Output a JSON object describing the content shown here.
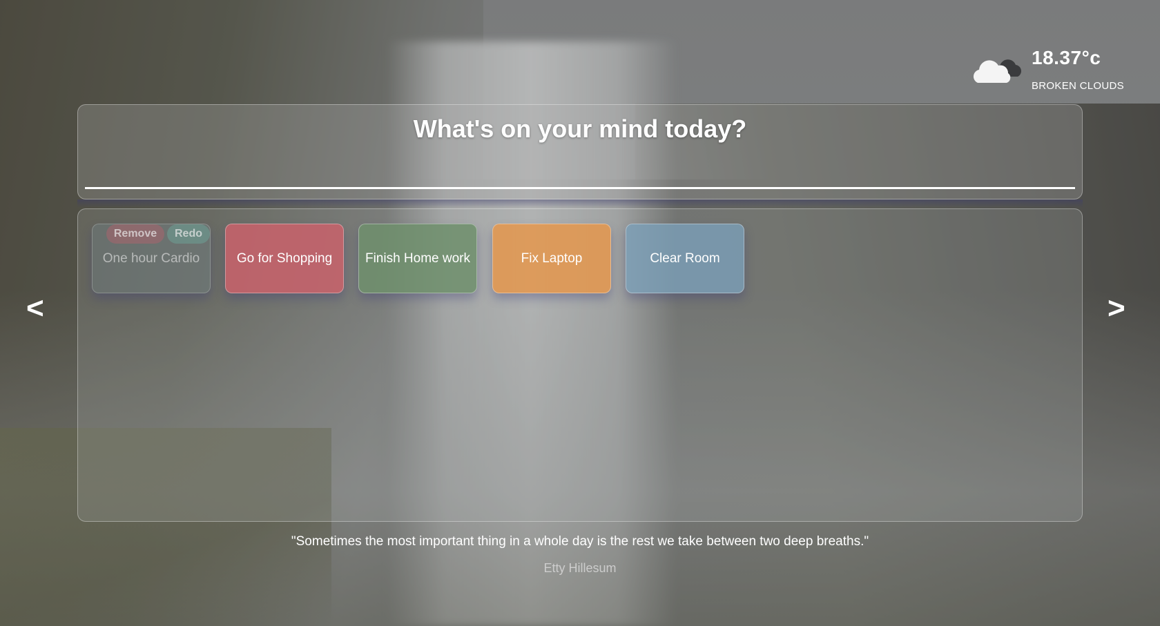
{
  "weather": {
    "icon": "broken-clouds-icon",
    "temperature": "18.37°c",
    "description": "BROKEN CLOUDS"
  },
  "input_panel": {
    "title": "What's on your mind today?",
    "input_value": "",
    "input_placeholder": ""
  },
  "tasks": [
    {
      "label": "One hour Cardio",
      "status": "completed",
      "color": "#7f98a8",
      "remove_label": "Remove",
      "redo_label": "Redo"
    },
    {
      "label": "Go for Shopping",
      "status": "active",
      "color": "#c9626b"
    },
    {
      "label": "Finish Home work",
      "status": "active",
      "color": "#6f8f6c"
    },
    {
      "label": "Fix Laptop",
      "status": "active",
      "color": "#e29750"
    },
    {
      "label": "Clear Room",
      "status": "active",
      "color": "#7b9fb8"
    }
  ],
  "nav": {
    "prev_label": "<",
    "next_label": ">"
  },
  "quote": {
    "text": "\"Sometimes the most important thing in a whole day is the rest we take between two deep breaths.\"",
    "author": "Etty Hillesum"
  }
}
